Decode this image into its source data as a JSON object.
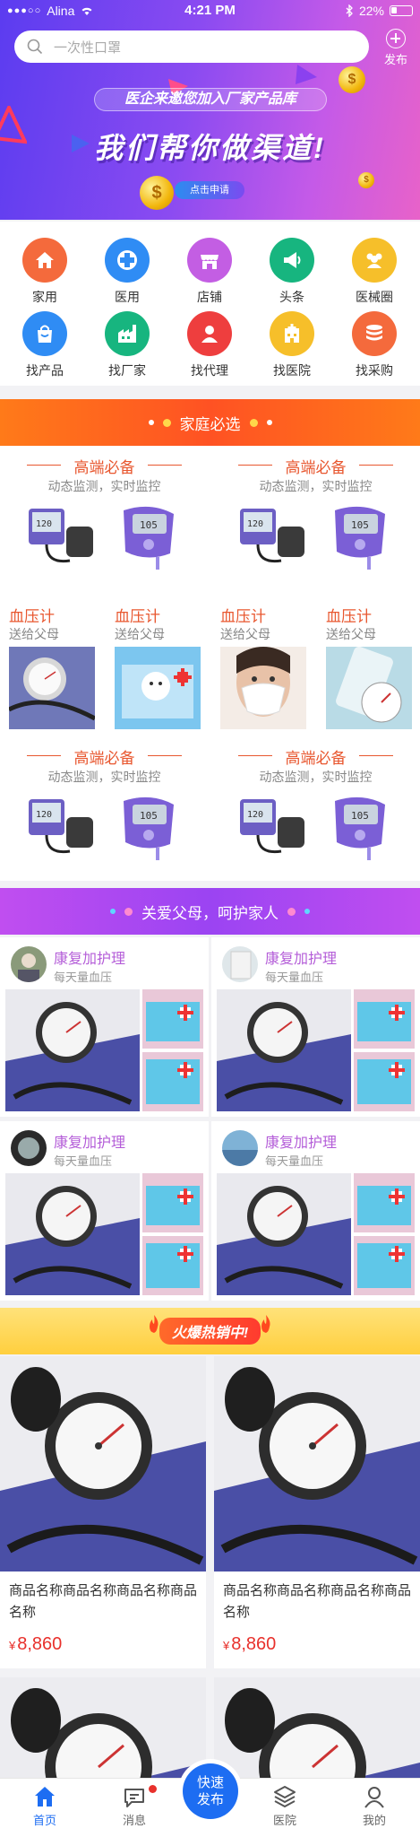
{
  "status_bar": {
    "carrier": "Alina",
    "signal": "●●●○○",
    "time": "4:21 PM",
    "battery": "22%"
  },
  "search": {
    "placeholder": "一次性口罩"
  },
  "header": {
    "publish_label": "发布"
  },
  "banner": {
    "subtitle": "医企来邀您加入厂家产品库",
    "title": "我们帮你做渠道!",
    "button": "点击申请"
  },
  "categories": [
    {
      "label": "家用",
      "icon": "home-icon",
      "color": "#f46a3c"
    },
    {
      "label": "医用",
      "icon": "medical-cross-icon",
      "color": "#2f8cf4"
    },
    {
      "label": "店铺",
      "icon": "store-icon",
      "color": "#c35ee3"
    },
    {
      "label": "头条",
      "icon": "megaphone-icon",
      "color": "#17b57f"
    },
    {
      "label": "医械圈",
      "icon": "people-icon",
      "color": "#f6bf2a"
    },
    {
      "label": "找产品",
      "icon": "bag-icon",
      "color": "#2f8cf4"
    },
    {
      "label": "找厂家",
      "icon": "factory-icon",
      "color": "#17b57f"
    },
    {
      "label": "找代理",
      "icon": "person-icon",
      "color": "#ee3e3e"
    },
    {
      "label": "找医院",
      "icon": "hospital-icon",
      "color": "#f6bf2a"
    },
    {
      "label": "找采购",
      "icon": "database-icon",
      "color": "#f46a3c"
    }
  ],
  "family_section": {
    "title": "家庭必选",
    "highend": [
      {
        "title": "高端必备",
        "subtitle": "动态监测，实时监控"
      },
      {
        "title": "高端必备",
        "subtitle": "动态监测，实时监控"
      },
      {
        "title": "高端必备",
        "subtitle": "动态监测，实时监控"
      },
      {
        "title": "高端必备",
        "subtitle": "动态监测，实时监控"
      }
    ],
    "bp_cards": [
      {
        "title": "血压计",
        "subtitle": "送给父母"
      },
      {
        "title": "血压计",
        "subtitle": "送给父母"
      },
      {
        "title": "血压计",
        "subtitle": "送给父母"
      },
      {
        "title": "血压计",
        "subtitle": "送给父母"
      }
    ]
  },
  "care_section": {
    "title": "关爱父母，呵护家人",
    "cards": [
      {
        "title": "康复加护理",
        "subtitle": "每天量血压"
      },
      {
        "title": "康复加护理",
        "subtitle": "每天量血压"
      },
      {
        "title": "康复加护理",
        "subtitle": "每天量血压"
      },
      {
        "title": "康复加护理",
        "subtitle": "每天量血压"
      }
    ]
  },
  "hot_section": {
    "title": "火爆热销中!",
    "products": [
      {
        "name": "商品名称商品名称商品名称商品名称",
        "currency": "¥",
        "price": "8,860"
      },
      {
        "name": "商品名称商品名称商品名称商品名称",
        "currency": "¥",
        "price": "8,860"
      }
    ]
  },
  "tabbar": {
    "home": "首页",
    "messages": "消息",
    "quick_publish": "快速发布",
    "hospital": "医院",
    "mine": "我的"
  },
  "colors": {
    "accent": "#1d6df2",
    "family_bar": "#ff5a1f",
    "care_bar": "#a44cf0",
    "price": "#e8312c"
  }
}
